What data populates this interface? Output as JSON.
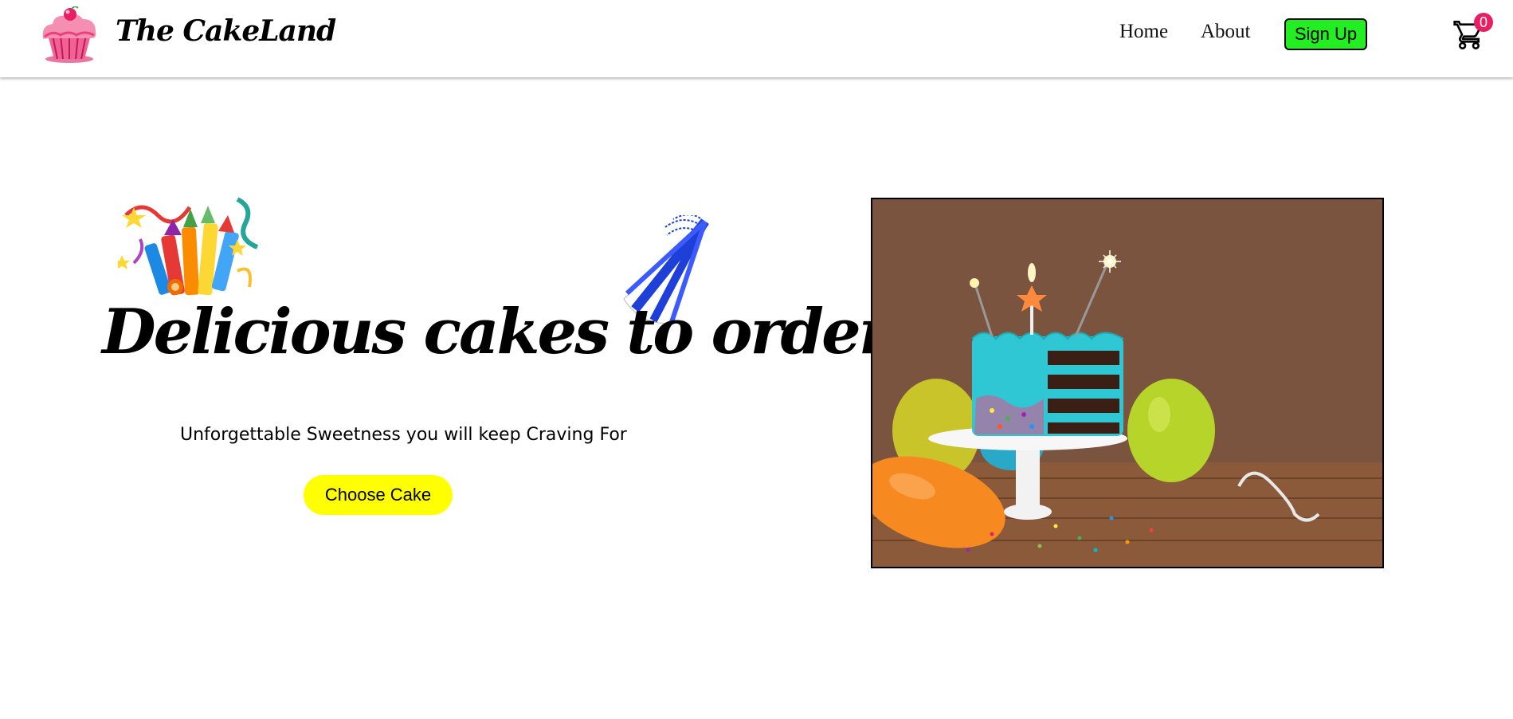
{
  "brand": {
    "name": "The CakeLand",
    "logo_icon": "cupcake-icon"
  },
  "nav": {
    "home": "Home",
    "about": "About",
    "signup": "Sign Up",
    "signup_color": "#22ee22",
    "cart_icon": "cart-icon",
    "cart_count": "0",
    "badge_color": "#e91e63"
  },
  "hero": {
    "title": "Delicious cakes to order",
    "subtitle": "Unforgettable Sweetness you will keep Craving For",
    "cta": "Choose Cake",
    "cta_color": "#ffff00",
    "decor_left": "fireworks-icon",
    "decor_right": "party-hat-icon",
    "image": "birthday-cake-with-balloons"
  }
}
